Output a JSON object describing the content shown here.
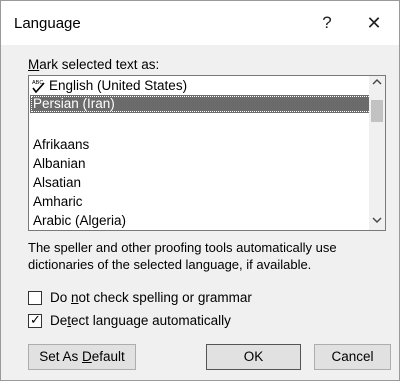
{
  "dialog": {
    "title": "Language",
    "help_glyph": "?",
    "close_glyph": "✕"
  },
  "mark_label": {
    "accel": "M",
    "rest": "ark selected text as:"
  },
  "list": {
    "items": [
      {
        "label": "English (United States)",
        "proofing": true,
        "selected": false
      },
      {
        "label": "Persian (Iran)",
        "proofing": false,
        "selected": true
      },
      {
        "label": "",
        "proofing": false,
        "selected": false
      },
      {
        "label": "Afrikaans",
        "proofing": false,
        "selected": false
      },
      {
        "label": "Albanian",
        "proofing": false,
        "selected": false
      },
      {
        "label": "Alsatian",
        "proofing": false,
        "selected": false
      },
      {
        "label": "Amharic",
        "proofing": false,
        "selected": false
      },
      {
        "label": "Arabic (Algeria)",
        "proofing": false,
        "selected": false
      }
    ],
    "scroll_up_glyph": "^",
    "scroll_down_glyph": "v"
  },
  "info_text": "The speller and other proofing tools automatically use dictionaries of the selected language, if available.",
  "checkboxes": {
    "no_check": {
      "pre": "Do ",
      "accel": "n",
      "post": "ot check spelling or grammar",
      "checked": false
    },
    "detect": {
      "pre": "De",
      "accel": "t",
      "post": "ect language automatically",
      "checked": true,
      "check_glyph": "✓"
    }
  },
  "buttons": {
    "set_default": {
      "pre": "Set As ",
      "accel": "D",
      "post": "efault"
    },
    "ok": "OK",
    "cancel": "Cancel"
  },
  "colors": {
    "selection": "#6b6b6b",
    "dialog_bg": "#f0f0f0",
    "titlebar_bg": "#ffffff"
  }
}
